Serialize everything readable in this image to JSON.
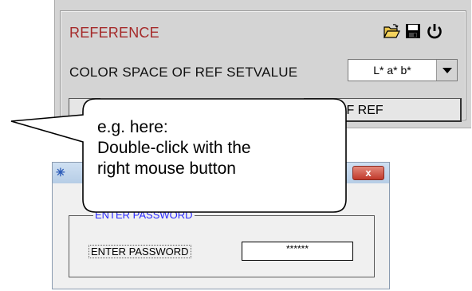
{
  "reference_panel": {
    "title": "REFERENCE",
    "color_space_label": "COLOR SPACE OF REF SETVALUE",
    "color_space_value": "L* a* b*",
    "button_label": "OF REF",
    "icons": [
      "folder-open-icon",
      "save-icon",
      "power-icon"
    ]
  },
  "callout": {
    "line1": "e.g. here:",
    "line2": "Double-click with the",
    "line3": "right mouse button"
  },
  "password_dialog": {
    "group_label": "ENTER PASSWORD",
    "field_label": "ENTER PASSWORD",
    "password_mask": "******",
    "close_glyph": "x"
  },
  "colors": {
    "title_red": "#a52a2a",
    "group_label_blue": "#2a2aff",
    "panel_gray": "#d4d4d4"
  }
}
